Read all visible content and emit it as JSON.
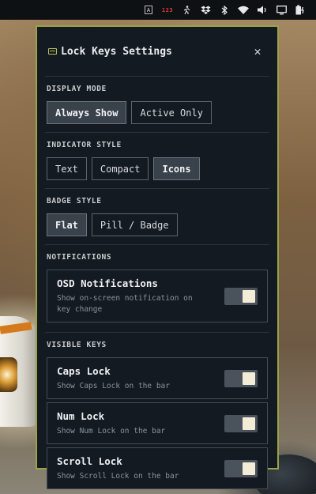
{
  "topbar": {
    "icons": [
      "capslock-indicator-icon",
      "numlock-123-icon",
      "person-run-icon",
      "dropbox-icon",
      "bluetooth-icon",
      "wifi-icon",
      "volume-icon",
      "display-icon",
      "battery-charging-icon"
    ],
    "numlock_text": "123",
    "capslock_text": "A"
  },
  "panel": {
    "title": "Lock Keys Settings",
    "close_label": "✕",
    "display_mode": {
      "label": "DISPLAY MODE",
      "options": [
        "Always Show",
        "Active Only"
      ],
      "selected": "Always Show"
    },
    "indicator_style": {
      "label": "INDICATOR STYLE",
      "options": [
        "Text",
        "Compact",
        "Icons"
      ],
      "selected": "Icons"
    },
    "badge_style": {
      "label": "BADGE STYLE",
      "options": [
        "Flat",
        "Pill / Badge"
      ],
      "selected": "Flat"
    },
    "notifications": {
      "label": "NOTIFICATIONS",
      "osd": {
        "title": "OSD Notifications",
        "description": "Show on-screen notification on key change",
        "enabled": true
      }
    },
    "visible_keys": {
      "label": "VISIBLE KEYS",
      "items": [
        {
          "title": "Caps Lock",
          "description": "Show Caps Lock on the bar",
          "enabled": true
        },
        {
          "title": "Num Lock",
          "description": "Show Num Lock on the bar",
          "enabled": true
        },
        {
          "title": "Scroll Lock",
          "description": "Show Scroll Lock on the bar",
          "enabled": true
        }
      ]
    }
  },
  "colors": {
    "accent_border": "#9aa24a",
    "panel_bg": "#141a21",
    "toggle_knob": "#f3ecd6"
  }
}
